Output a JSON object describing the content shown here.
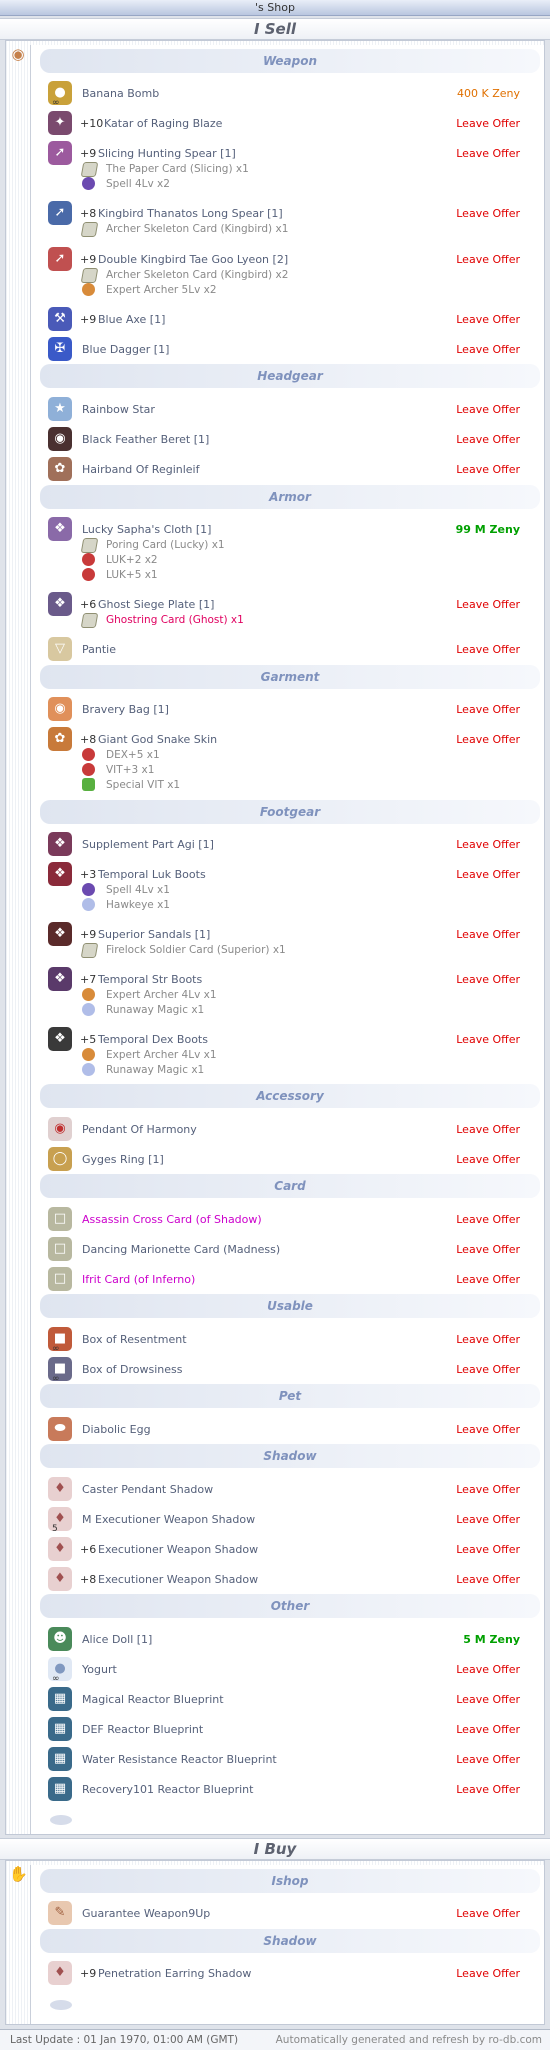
{
  "header": {
    "title": "'s Shop"
  },
  "sell": {
    "title": "I Sell",
    "categories": {
      "weapon": "Weapon",
      "headgear": "Headgear",
      "armor": "Armor",
      "garment": "Garment",
      "footgear": "Footgear",
      "accessory": "Accessory",
      "card": "Card",
      "usable": "Usable",
      "pet": "Pet",
      "shadow": "Shadow",
      "other": "Other"
    },
    "items": [
      {
        "name": "Banana Bomb",
        "price": "400 K Zeny"
      },
      {
        "refine": "+10",
        "name": "Katar of  Raging Blaze",
        "price": "Leave Offer"
      },
      {
        "refine": "+9",
        "name": "Slicing Hunting Spear [1]",
        "price": "Leave Offer",
        "subs": [
          "The Paper Card (Slicing) x1",
          "Spell 4Lv x2"
        ]
      },
      {
        "refine": "+8",
        "name": "Kingbird Thanatos Long Spear [1]",
        "price": "Leave Offer",
        "subs": [
          "Archer Skeleton Card (Kingbird) x1"
        ]
      },
      {
        "refine": "+9",
        "name": "Double Kingbird Tae Goo Lyeon [2]",
        "price": "Leave Offer",
        "subs": [
          "Archer Skeleton Card (Kingbird) x2",
          "Expert Archer 5Lv x2"
        ]
      },
      {
        "refine": "+9",
        "name": "Blue Axe [1]",
        "price": "Leave Offer"
      },
      {
        "name": "Blue Dagger [1]",
        "price": "Leave Offer"
      },
      {
        "name": "Rainbow Star",
        "price": "Leave Offer"
      },
      {
        "name": "Black Feather Beret [1]",
        "price": "Leave Offer"
      },
      {
        "name": "Hairband Of Reginleif",
        "price": "Leave Offer"
      },
      {
        "name": "Lucky Sapha's Cloth [1]",
        "price": "99 M Zeny",
        "subs": [
          "Poring Card (Lucky) x1",
          "LUK+2 x2",
          "LUK+5 x1"
        ]
      },
      {
        "refine": "+6",
        "name": "Ghost Siege Plate [1]",
        "price": "Leave Offer",
        "subs": [
          "Ghostring Card (Ghost) x1"
        ]
      },
      {
        "name": "Pantie",
        "price": "Leave Offer"
      },
      {
        "name": "Bravery Bag [1]",
        "price": "Leave Offer"
      },
      {
        "refine": "+8",
        "name": "Giant God Snake Skin",
        "price": "Leave Offer",
        "subs": [
          "DEX+5 x1",
          "VIT+3 x1",
          "Special VIT x1"
        ]
      },
      {
        "name": "Supplement Part Agi [1]",
        "price": "Leave Offer"
      },
      {
        "refine": "+3",
        "name": "Temporal Luk Boots",
        "price": "Leave Offer",
        "subs": [
          "Spell 4Lv x1",
          "Hawkeye x1"
        ]
      },
      {
        "refine": "+9",
        "name": "Superior Sandals [1]",
        "price": "Leave Offer",
        "subs": [
          "Firelock Soldier Card (Superior) x1"
        ]
      },
      {
        "refine": "+7",
        "name": "Temporal Str Boots",
        "price": "Leave Offer",
        "subs": [
          "Expert Archer 4Lv x1",
          "Runaway Magic x1"
        ]
      },
      {
        "refine": "+5",
        "name": "Temporal Dex Boots",
        "price": "Leave Offer",
        "subs": [
          "Expert Archer 4Lv x1",
          "Runaway Magic x1"
        ]
      },
      {
        "name": "Pendant Of Harmony",
        "price": "Leave Offer"
      },
      {
        "name": "Gyges Ring [1]",
        "price": "Leave Offer"
      },
      {
        "name": "Assassin Cross Card (of Shadow)",
        "price": "Leave Offer"
      },
      {
        "name": "Dancing Marionette Card (Madness)",
        "price": "Leave Offer"
      },
      {
        "name": "Ifrit Card (of Inferno)",
        "price": "Leave Offer"
      },
      {
        "name": "Box of Resentment",
        "price": "Leave Offer"
      },
      {
        "name": "Box of Drowsiness",
        "price": "Leave Offer"
      },
      {
        "name": "Diabolic Egg",
        "price": "Leave Offer"
      },
      {
        "name": "Caster Pendant Shadow",
        "price": "Leave Offer"
      },
      {
        "name": "M Executioner Weapon Shadow",
        "price": "Leave Offer",
        "qty": "5"
      },
      {
        "refine": "+6",
        "name": "Executioner Weapon Shadow",
        "price": "Leave Offer"
      },
      {
        "refine": "+8",
        "name": "Executioner Weapon Shadow",
        "price": "Leave Offer"
      },
      {
        "name": "Alice Doll [1]",
        "price": "5 M Zeny"
      },
      {
        "name": "Yogurt",
        "price": "Leave Offer"
      },
      {
        "name": "Magical Reactor Blueprint",
        "price": "Leave Offer"
      },
      {
        "name": "DEF Reactor Blueprint",
        "price": "Leave Offer"
      },
      {
        "name": "Water Resistance Reactor Blueprint",
        "price": "Leave Offer"
      },
      {
        "name": "Recovery101 Reactor Blueprint",
        "price": "Leave Offer"
      }
    ]
  },
  "buy": {
    "title": "I Buy",
    "categories": {
      "ishop": "Ishop",
      "shadow": "Shadow"
    },
    "items": [
      {
        "name": "Guarantee Weapon9Up",
        "price": "Leave Offer"
      },
      {
        "refine": "+9",
        "name": "Penetration Earring Shadow",
        "price": "Leave Offer"
      }
    ]
  },
  "icons": {
    "bag": "money-bag-icon",
    "hand": "hand-icon"
  },
  "colors": {
    "price_offer": "#e00000",
    "price_zeny": "#e07000",
    "price_green": "#00a000",
    "category": "#7f92bd",
    "pink": "#cc00cc"
  },
  "footer": {
    "last_update": "Last Update : 01 Jan 1970, 01:00 AM (GMT)",
    "note": "Automatically generated and refresh by ro-db.com"
  }
}
